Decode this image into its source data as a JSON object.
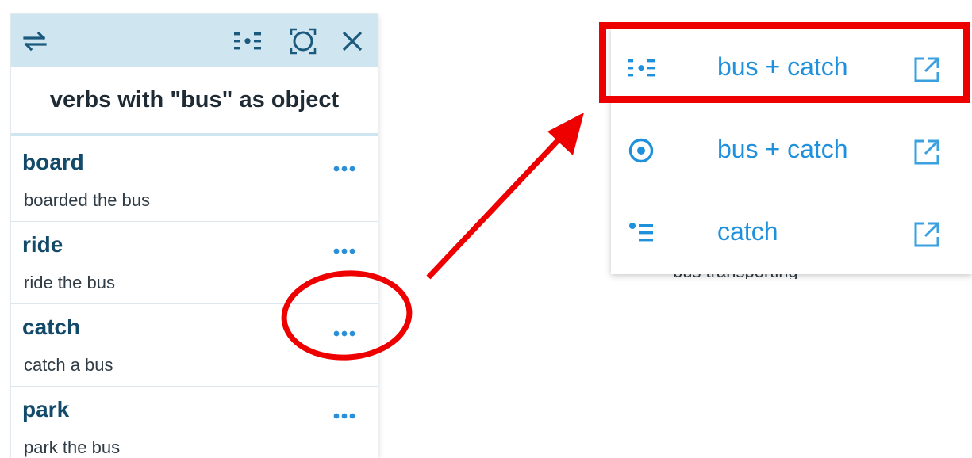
{
  "panel": {
    "title": "verbs with \"bus\" as object",
    "header_icons": [
      "swap-arrows-icon",
      "word-sketch-icon",
      "focus-circle-icon",
      "close-icon"
    ],
    "items": [
      {
        "word": "board",
        "example": "boarded the bus"
      },
      {
        "word": "ride",
        "example": "ride the bus"
      },
      {
        "word": "catch",
        "example": "catch a bus"
      },
      {
        "word": "park",
        "example": "park the bus"
      }
    ],
    "more_icon": "more-dots-icon"
  },
  "menu": {
    "items": [
      {
        "label": "bus + catch",
        "icon": "word-sketch-icon",
        "ext_icon": "open-in-new-icon"
      },
      {
        "label": "bus + catch",
        "icon": "concordance-target-icon",
        "ext_icon": "open-in-new-icon"
      },
      {
        "label": "catch",
        "icon": "list-icon",
        "ext_icon": "open-in-new-icon"
      }
    ],
    "behind_text": "bus transporting"
  },
  "colors": {
    "header_bg": "#cfe6f1",
    "word_color": "#134a6a",
    "accent_blue": "#1e90dc",
    "annotation_red": "#ee0000"
  }
}
